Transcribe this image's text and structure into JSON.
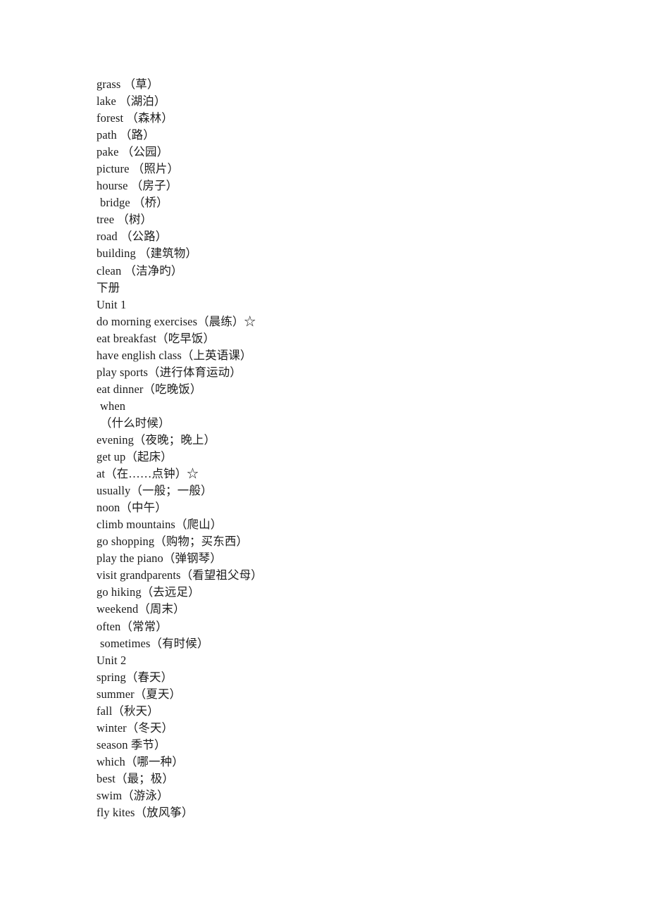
{
  "document": {
    "type": "vocabulary-word-list",
    "background_color": "#ffffff",
    "text_color": "#1c1c1c",
    "lines": [
      {
        "text": "grass （草）",
        "indent": false
      },
      {
        "text": "lake （湖泊）",
        "indent": false
      },
      {
        "text": "forest （森林）",
        "indent": false
      },
      {
        "text": "path （路）",
        "indent": false
      },
      {
        "text": "pake （公园）",
        "indent": false
      },
      {
        "text": "picture （照片）",
        "indent": false
      },
      {
        "text": "hourse （房子）",
        "indent": false
      },
      {
        "text": "bridge （桥）",
        "indent": true
      },
      {
        "text": "tree （树）",
        "indent": false
      },
      {
        "text": "road （公路）",
        "indent": false
      },
      {
        "text": "building （建筑物）",
        "indent": false
      },
      {
        "text": "clean （洁净旳）",
        "indent": false
      },
      {
        "text": "下册",
        "indent": false
      },
      {
        "text": "Unit 1",
        "indent": false
      },
      {
        "text": "do morning exercises（晨练）☆",
        "indent": false
      },
      {
        "text": "eat breakfast（吃早饭）",
        "indent": false
      },
      {
        "text": "have english class（上英语课）",
        "indent": false
      },
      {
        "text": "play sports（进行体育运动）",
        "indent": false
      },
      {
        "text": "eat dinner（吃晚饭）",
        "indent": false
      },
      {
        "text": "when",
        "indent": true
      },
      {
        "text": "（什么时候）",
        "indent": true
      },
      {
        "text": "evening（夜晚；晚上）",
        "indent": false
      },
      {
        "text": "get up（起床）",
        "indent": false
      },
      {
        "text": "at（在……点钟）☆",
        "indent": false
      },
      {
        "text": "usually（一般；一般）",
        "indent": false
      },
      {
        "text": "noon（中午）",
        "indent": false
      },
      {
        "text": "climb mountains（爬山）",
        "indent": false
      },
      {
        "text": "go shopping（购物；买东西）",
        "indent": false
      },
      {
        "text": "play the piano（弹钢琴）",
        "indent": false
      },
      {
        "text": "visit grandparents（看望祖父母）",
        "indent": false
      },
      {
        "text": "go hiking（去远足）",
        "indent": false
      },
      {
        "text": "weekend（周末）",
        "indent": false
      },
      {
        "text": "often（常常）",
        "indent": false
      },
      {
        "text": "sometimes（有时候）",
        "indent": true
      },
      {
        "text": "Unit 2",
        "indent": false
      },
      {
        "text": "spring（春天）",
        "indent": false
      },
      {
        "text": "summer（夏天）",
        "indent": false
      },
      {
        "text": "fall（秋天）",
        "indent": false
      },
      {
        "text": "winter（冬天）",
        "indent": false
      },
      {
        "text": "season 季节）",
        "indent": false
      },
      {
        "text": "which（哪一种）",
        "indent": false
      },
      {
        "text": "best（最；极）",
        "indent": false
      },
      {
        "text": "swim（游泳）",
        "indent": false
      },
      {
        "text": "fly kites（放风筝）",
        "indent": false
      }
    ]
  }
}
